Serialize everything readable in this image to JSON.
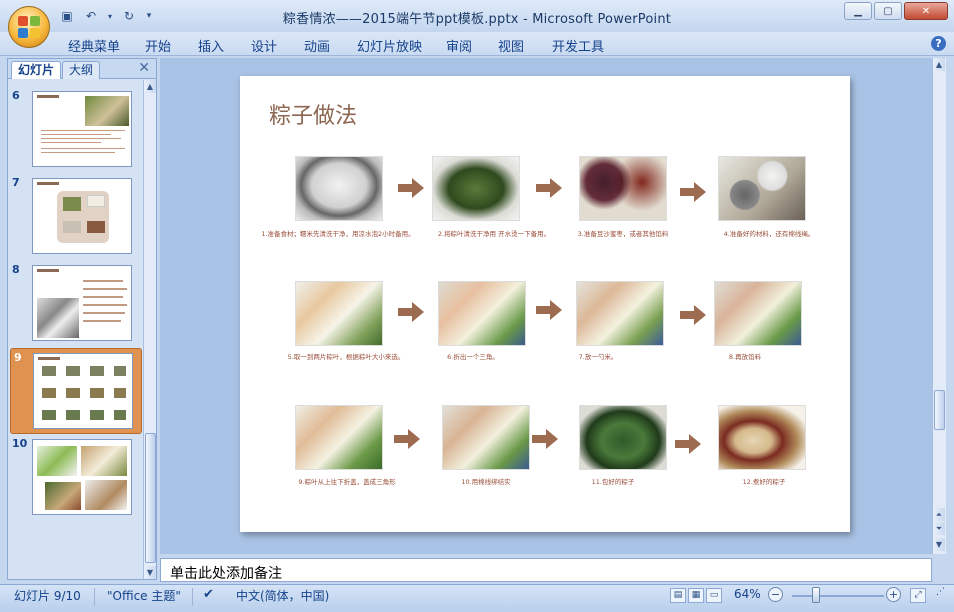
{
  "window": {
    "title": "粽香情浓——2015端午节ppt模板.pptx - Microsoft PowerPoint"
  },
  "menu": [
    "经典菜单",
    "开始",
    "插入",
    "设计",
    "动画",
    "幻灯片放映",
    "审阅",
    "视图",
    "开发工具"
  ],
  "pane_tabs": {
    "slides": "幻灯片",
    "outline": "大纲"
  },
  "thumbnails": [
    {
      "num": "6"
    },
    {
      "num": "7"
    },
    {
      "num": "8"
    },
    {
      "num": "9"
    },
    {
      "num": "10"
    }
  ],
  "slide": {
    "title": "粽子做法",
    "steps": [
      "1.准备食材；糯米先清洗干净，用凉水泡2小时备用。",
      "2.将粽叶清洗干净用 开水烫一下备用。",
      "3.准备豆沙蜜枣，或者其他馅料",
      "4.准备好的材料，还有棉线绳。",
      "5.取一到两片粽叶，根据粽叶大小来选。",
      "6.折出一个三角。",
      "7.放一勺米。",
      "8.再放馅料",
      "9.粽叶从上往下折盖，盖成三角形",
      "10.用棉线绑结实",
      "11.包好的粽子",
      "12.煮好的粽子"
    ]
  },
  "notes": {
    "placeholder": "单击此处添加备注"
  },
  "status": {
    "slide": "幻灯片 9/10",
    "theme": "\"Office 主题\"",
    "language": "中文(简体，中国)",
    "zoom": "64%"
  },
  "colors": {
    "accent": "#8c6650",
    "arrow": "#9c6b50",
    "selected_thumb": "#e09350"
  }
}
